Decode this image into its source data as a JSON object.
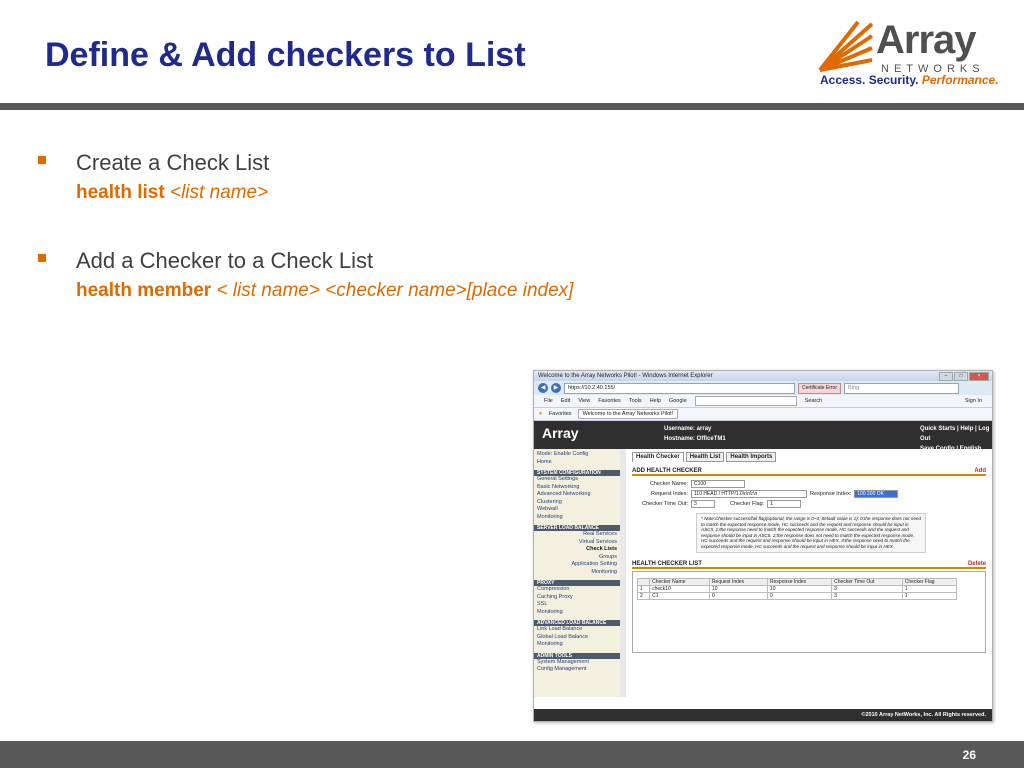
{
  "slide": {
    "title": "Define & Add checkers to List",
    "page_number": "26",
    "bullets": [
      {
        "text": "Create a Check List",
        "cmd_bold": "health list",
        "cmd_args": "<list name>"
      },
      {
        "text": "Add a Checker to a Check List",
        "cmd_bold": "health member",
        "cmd_args": "< list name> <checker name>[place index]"
      }
    ]
  },
  "logo": {
    "word": "Array",
    "networks": "NETWORKS",
    "tag_main": "Access. Security.",
    "tag_perf": "Performance."
  },
  "colors": {
    "title": "#1f2a8c",
    "accent": "#e06a00",
    "bar": "#585858",
    "text": "#404040"
  },
  "screenshot": {
    "window_title": "Welcome to the Array Networks Pilot! - Windows Internet Explorer",
    "address": "https://10.2.40.155/",
    "cert": "Certificate Error",
    "search_placeholder": "Bing",
    "menu": [
      "File",
      "Edit",
      "View",
      "Favorites",
      "Tools",
      "Help"
    ],
    "google": "Google",
    "toolbar_search": "Search",
    "sign_in": "Sign In",
    "favorites": "Favorites",
    "tab": "Welcome to the Array Networks Pilot!",
    "app_logo": "Array",
    "username": "Username: array",
    "hostname": "Hostname: OfficeTM1",
    "quick": "Quick Starts | Help | Log Out",
    "save": "Save Config | English",
    "mode": "Mode: Enable Config",
    "side": {
      "home": "Home",
      "sys_head": "SYSTEM CONFIGURATION",
      "sys": [
        "General Settings",
        "Basic Networking",
        "Advanced Networking",
        "Clustering",
        "Webwall",
        "Monitoring"
      ],
      "slb_head": "SERVER LOAD BALANCE",
      "slb": [
        "Real Services",
        "Virtual Services",
        "Check Lists",
        "Groups",
        "Application Setting",
        "Monitoring"
      ],
      "proxy_head": "PROXY",
      "proxy": [
        "Compression",
        "Caching Proxy",
        "SSL",
        "Monitoring"
      ],
      "alb_head": "ADVANCED LOAD BALANCE",
      "alb": [
        "Link Load Balance",
        "Global Load Balance",
        "Monitoring"
      ],
      "admin_head": "ADMIN TOOLS",
      "admin": [
        "System Management",
        "Config Management"
      ]
    },
    "tabs": [
      "Health Checker",
      "Health List",
      "Health Imports"
    ],
    "add_section": "ADD HEALTH CHECKER",
    "add_action": "Add",
    "form": {
      "checker_name_label": "Checker Name:",
      "checker_name": "C100",
      "request_label": "Request Index:",
      "request": "110 HEAD / HTTP/1.0\\r\\n\\r\\n",
      "response_label": "Response Index:",
      "response": "100 200 OK",
      "timeout_label": "Checker Time Out:",
      "timeout": "3",
      "flag_label": "Checker Flag:",
      "flag": "1"
    },
    "note": "* Note:Checker success/fail flag(optional, the range is 0~3, default value is 1): 0:the response does not need to match the expected response mode, HC succeeds and the request and response should be input in ASCII. 1:the response need to match the expected response mode, HC succeeds and the request and response should be input in ASCII. 2:the response does not need to match the expected response mode, HC succeeds and the request and response should be input in HEX. 3:the response need to match the expected response mode, HC succeeds and the request and response should be input in HEX.",
    "list_section": "HEALTH CHECKER LIST",
    "list_action": "Delete",
    "columns": [
      "",
      "Checker Name",
      "Request Index",
      "Response Index",
      "Checker Time Out",
      "Checker Flag"
    ],
    "rows": [
      [
        "1",
        "check10",
        "10",
        "10",
        "3",
        "1"
      ],
      [
        "2",
        "C1",
        "0",
        "0",
        "3",
        "1"
      ]
    ],
    "copyright": "©2010 Array NetWorks, Inc. All Rights reserved."
  }
}
